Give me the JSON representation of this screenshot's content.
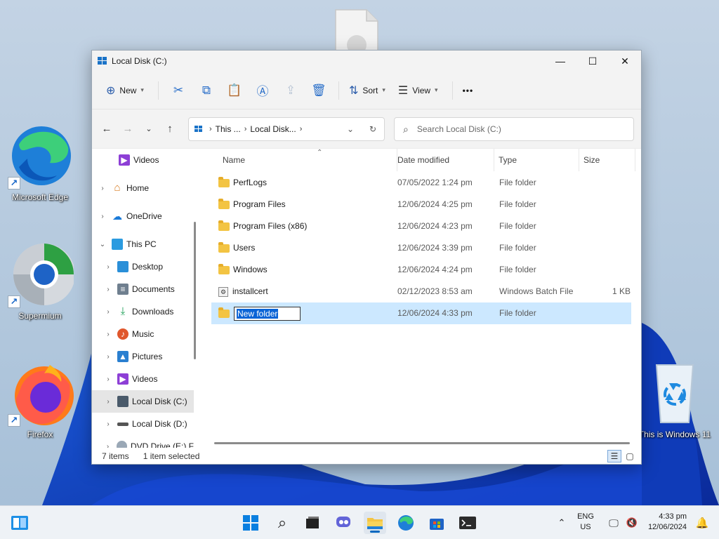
{
  "desktop": {
    "icons": [
      {
        "label": "Microsoft Edge"
      },
      {
        "label": "Supermium"
      },
      {
        "label": "Firefox"
      },
      {
        "label": "This is Windows 11"
      }
    ]
  },
  "window": {
    "title": "Local Disk (C:)",
    "caption": {
      "minimize": "—",
      "maximize": "☐",
      "close": "✕"
    }
  },
  "commands": {
    "new_label": "New",
    "sort_label": "Sort",
    "view_label": "View",
    "more_label": "•••"
  },
  "address": {
    "crumbs": [
      "This ...",
      "Local Disk..."
    ]
  },
  "search": {
    "placeholder": "Search Local Disk (C:)"
  },
  "nav_pane": {
    "items": [
      {
        "label": "Videos"
      },
      {
        "label": "Home"
      },
      {
        "label": "OneDrive"
      },
      {
        "label": "This PC"
      },
      {
        "label": "Desktop"
      },
      {
        "label": "Documents"
      },
      {
        "label": "Downloads"
      },
      {
        "label": "Music"
      },
      {
        "label": "Pictures"
      },
      {
        "label": "Videos"
      },
      {
        "label": "Local Disk (C:)"
      },
      {
        "label": "Local Disk (D:)"
      },
      {
        "label": "DVD Drive (E:) F"
      }
    ]
  },
  "columns": {
    "name": "Name",
    "date": "Date modified",
    "type": "Type",
    "size": "Size"
  },
  "files": [
    {
      "name": "PerfLogs",
      "date": "07/05/2022 1:24 pm",
      "type": "File folder",
      "size": ""
    },
    {
      "name": "Program Files",
      "date": "12/06/2024 4:25 pm",
      "type": "File folder",
      "size": ""
    },
    {
      "name": "Program Files (x86)",
      "date": "12/06/2024 4:23 pm",
      "type": "File folder",
      "size": ""
    },
    {
      "name": "Users",
      "date": "12/06/2024 3:39 pm",
      "type": "File folder",
      "size": ""
    },
    {
      "name": "Windows",
      "date": "12/06/2024 4:24 pm",
      "type": "File folder",
      "size": ""
    },
    {
      "name": "installcert",
      "date": "02/12/2023 8:53 am",
      "type": "Windows Batch File",
      "size": "1 KB"
    },
    {
      "name": "New folder",
      "date": "12/06/2024 4:33 pm",
      "type": "File folder",
      "size": ""
    }
  ],
  "status": {
    "count": "7 items",
    "selected": "1 item selected"
  },
  "tray": {
    "lang_top": "ENG",
    "lang_bottom": "US",
    "time": "4:33 pm",
    "date": "12/06/2024"
  },
  "colors": {
    "accent": "#0067c0",
    "selection": "#cce8ff"
  }
}
